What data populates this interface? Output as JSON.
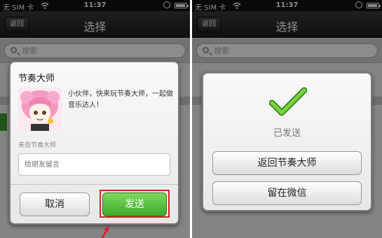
{
  "left": {
    "status": {
      "carrier": "无 SIM 卡",
      "time": "11:37"
    },
    "nav": {
      "back": "返回",
      "title": "选择"
    },
    "search": {
      "placeholder": "搜索"
    },
    "dialog": {
      "app_name": "节奏大师",
      "description": "小伙伴，快来玩节奏大师，一起做音乐达人！",
      "source": "来自节奏大师",
      "message_placeholder": "给朋友留言",
      "cancel": "取消",
      "send": "发送"
    }
  },
  "right": {
    "status": {
      "carrier": "无 SIM 卡",
      "time": "11:37"
    },
    "nav": {
      "back": "返回",
      "title": "选择"
    },
    "search": {
      "placeholder": "搜索"
    },
    "dialog": {
      "status": "已发送",
      "return_button": "返回节奏大师",
      "stay_button": "留在微信"
    }
  },
  "colors": {
    "send_green": "#3da92b",
    "highlight_red": "#d72020",
    "check_green": "#5cbf2a"
  },
  "icons": [
    "wifi-icon",
    "lock-rotation-icon",
    "battery-icon",
    "search-icon",
    "checkmark-icon",
    "avatar-image",
    "arrow-pointer-icon"
  ]
}
